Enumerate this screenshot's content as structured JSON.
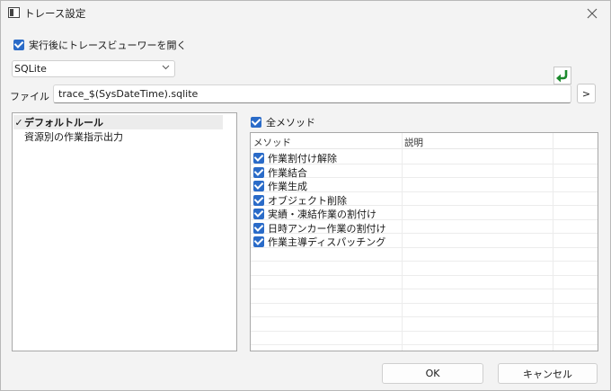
{
  "window": {
    "title": "トレース設定"
  },
  "options": {
    "open_viewer_label": "実行後にトレースビューワーを開く",
    "open_viewer_checked": true
  },
  "database": {
    "selected": "SQLite"
  },
  "file": {
    "label": "ファイル",
    "value": "trace_$(SysDateTime).sqlite",
    "browse_label": ">"
  },
  "rules": [
    {
      "label": "デフォルトルール",
      "checkmark": "✓",
      "selected": true
    },
    {
      "label": "資源別の作業指示出力",
      "checkmark": "",
      "selected": false
    }
  ],
  "methods": {
    "all_label": "全メソッド",
    "all_checked": true,
    "columns": [
      "メソッド",
      "説明"
    ],
    "rows": [
      {
        "name": "作業割付け解除",
        "description": "",
        "checked": true
      },
      {
        "name": "作業結合",
        "description": "",
        "checked": true
      },
      {
        "name": "作業生成",
        "description": "",
        "checked": true
      },
      {
        "name": "オブジェクト削除",
        "description": "",
        "checked": true
      },
      {
        "name": "実績・凍結作業の割付け",
        "description": "",
        "checked": true
      },
      {
        "name": "日時アンカー作業の割付け",
        "description": "",
        "checked": true
      },
      {
        "name": "作業主導ディスパッチング",
        "description": "",
        "checked": true
      }
    ]
  },
  "buttons": {
    "ok": "OK",
    "cancel": "キャンセル"
  },
  "colors": {
    "accent": "#2a6bc8",
    "refresh_arrow": "#1d8a2e"
  }
}
